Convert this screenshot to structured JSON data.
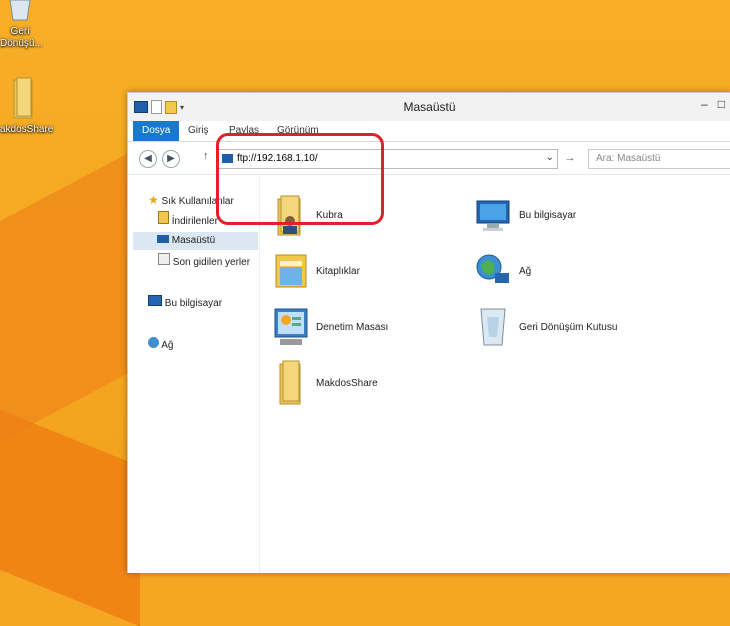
{
  "desktop": {
    "recycle_bin_label_1": "Geri",
    "recycle_bin_label_2": "Dönüşü...",
    "share_label": "akdosShare"
  },
  "window": {
    "title": "Masaüstü",
    "minimize": "–",
    "maximize": "□"
  },
  "ribbon": {
    "tabs": [
      "Dosya",
      "Giriş",
      "Paylaş",
      "Görünüm"
    ]
  },
  "address": {
    "value": "ftp://192.168.1.10/",
    "search_placeholder": "Ara: Masaüstü"
  },
  "nav": {
    "favorites": "Sık Kullanılanlar",
    "downloads": "İndirilenler",
    "desktop": "Masaüstü",
    "recent": "Son gidilen yerler",
    "this_pc": "Bu bilgisayar",
    "network": "Ağ"
  },
  "items": [
    {
      "name": "Kubra",
      "icon": "user-folder-icon"
    },
    {
      "name": "Bu bilgisayar",
      "icon": "computer-icon"
    },
    {
      "name": "Kitaplıklar",
      "icon": "libraries-icon"
    },
    {
      "name": "Ağ",
      "icon": "network-icon"
    },
    {
      "name": "Denetim Masası",
      "icon": "control-panel-icon"
    },
    {
      "name": "Geri Dönüşüm Kutusu",
      "icon": "recycle-bin-icon"
    },
    {
      "name": "MakdosShare",
      "icon": "folder-icon"
    }
  ],
  "colors": {
    "accent": "#1979ca",
    "highlight": "#e0212b",
    "desktop": "#f5a623"
  }
}
